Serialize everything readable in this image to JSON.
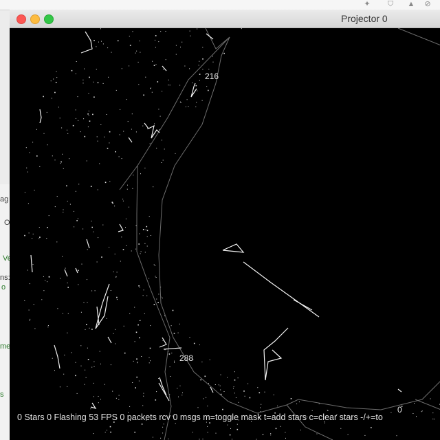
{
  "system_menubar": {
    "icons": [
      "dropbox-icon",
      "shield-icon",
      "bell-icon",
      "blocked-icon"
    ]
  },
  "window": {
    "title": "Projector 0",
    "controls": [
      "close",
      "minimize",
      "maximize"
    ]
  },
  "background_window": {
    "fragments": [
      "ag",
      "O",
      "Ve",
      "ns:",
      "o",
      "me",
      "s"
    ]
  },
  "projector": {
    "markers": [
      {
        "label": "216"
      },
      {
        "label": "288"
      },
      {
        "label": "0"
      }
    ]
  },
  "status_bar": {
    "text": "0 Stars   0 Flashing   53 FPS  0 packets rcv   0 msgs    m=toggle mask  t=add stars  c=clear stars  -/+=to"
  }
}
